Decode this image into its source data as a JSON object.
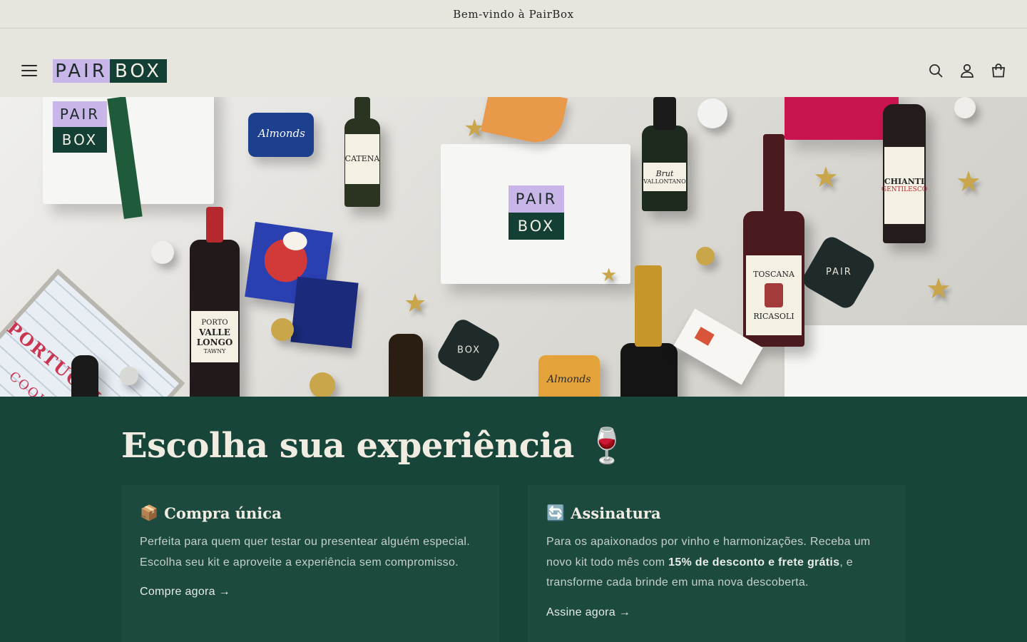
{
  "announcement": {
    "text": "Bem-vindo à PairBox"
  },
  "header": {
    "logo": {
      "left": "PAIR",
      "right": "BOX",
      "colors": {
        "pair_bg": "#c9b6e8",
        "box_bg": "#143f35"
      }
    },
    "icons": [
      "menu-icon",
      "search-icon",
      "account-icon",
      "cart-icon"
    ]
  },
  "hero": {
    "box_logo": {
      "top": "PAIR",
      "bottom": "BOX"
    },
    "labels": {
      "catena": "CATENA",
      "porto": "PORTO",
      "valle_longo": "VALLE LONGO",
      "tawny": "TAWNY",
      "chianti": "CHIANTI",
      "gentilesco": "GENTILESCO",
      "toscana": "TOSCANA",
      "ricasoli": "RICASOLI",
      "brut": "Brut",
      "vallontano": "VALLONTANO",
      "almonds": "Almonds",
      "portugal": "PORTUGAL",
      "cookbook": "COOKBOOK"
    }
  },
  "experience": {
    "title": "Escolha sua experiência",
    "title_emoji": "🍷",
    "cards": [
      {
        "emoji": "📦",
        "title": "Compra única",
        "text": "Perfeita para quem quer testar ou presentear alguém especial. Escolha seu kit e aproveite a experiência sem compromisso.",
        "link": "Compre agora →"
      },
      {
        "emoji": "🔄",
        "title": "Assinatura",
        "text_before": "Para os apaixonados por vinho e harmonizações. Receba um novo kit todo mês com ",
        "text_bold": "15% de desconto e frete grátis",
        "text_after": ", e transforme cada brinde em uma nova descoberta.",
        "link": "Assine agora →"
      }
    ],
    "colors": {
      "background": "#17453a",
      "card": "#1d4a3f",
      "heading": "#f1ece1"
    }
  }
}
